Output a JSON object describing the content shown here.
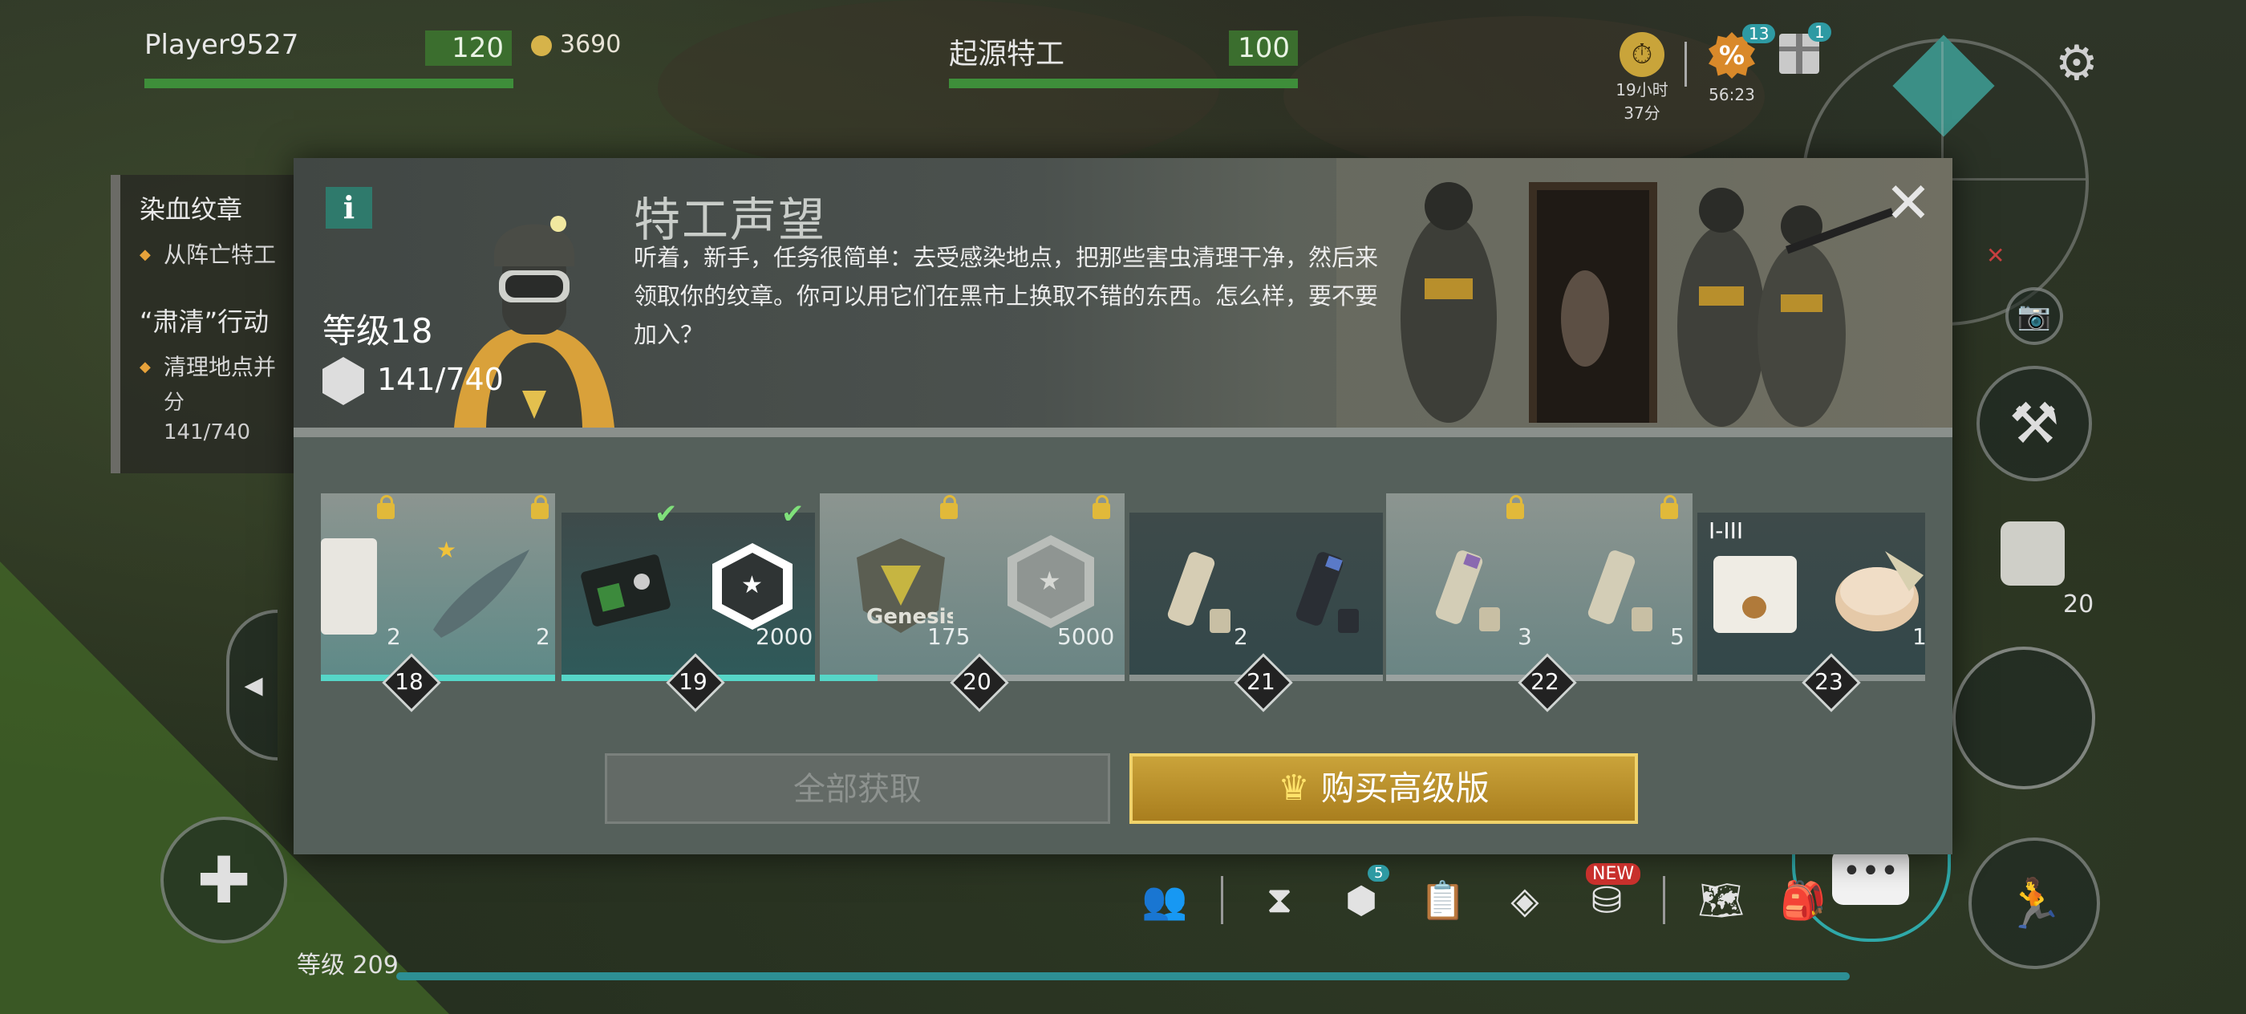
{
  "hud": {
    "player_name": "Player9527",
    "player_hp": "120",
    "coins": "3690",
    "agent_name": "起源特工",
    "agent_hp": "100",
    "timer_hours": "19小时",
    "timer_minutes": "37分",
    "sale_badge": "13",
    "sale_timer": "56:23",
    "gift_badge": "1",
    "item_count": "20"
  },
  "quests": {
    "quest1_title": "染血纹章",
    "quest1_item": "从阵亡特工",
    "quest2_title": "“肃清”行动",
    "quest2_item": "清理地点并",
    "quest2_item_cont": "分",
    "quest2_progress": "141/740"
  },
  "modal": {
    "title": "特工声望",
    "description": "听着，新手，任务很简单：去受感染地点，把那些害虫清理干净，然后来领取你的纹章。你可以用它们在黑市上换取不错的东西。怎么样，要不要加入？",
    "level_label": "等级18",
    "reputation": "141/740",
    "claim_all_label": "全部获取",
    "buy_premium_label": "购买高级版"
  },
  "rewards": [
    {
      "level": "18",
      "free_count": "2",
      "premium_count": "2",
      "locked": true,
      "progress": 1.0
    },
    {
      "level": "19",
      "free_count": "",
      "premium_count": "2000",
      "claimed": true,
      "progress": 1.0
    },
    {
      "level": "20",
      "free_count": "175",
      "premium_count": "5000",
      "locked": true,
      "progress": 0.19
    },
    {
      "level": "21",
      "free_count": "2",
      "premium_count": "",
      "locked": false,
      "progress": 0
    },
    {
      "level": "22",
      "free_count": "3",
      "premium_count": "5",
      "locked": true,
      "progress": 0
    },
    {
      "level": "23",
      "free_count": "",
      "premium_count": "1",
      "tier": "I-III",
      "progress": 0
    }
  ],
  "reward_labels": {
    "genesis_badge": "Genesis"
  },
  "bottom": {
    "level_label": "等级 209",
    "new_badge": "NEW",
    "badge_5": "5"
  }
}
